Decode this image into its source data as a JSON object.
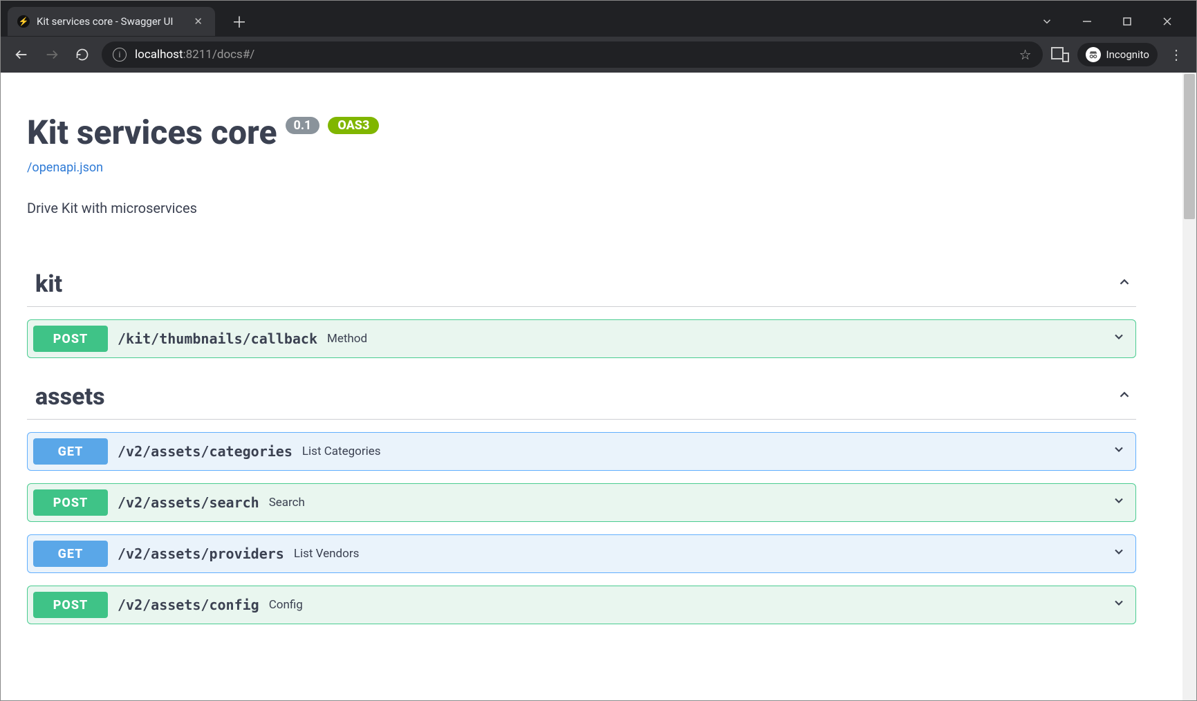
{
  "browser": {
    "tab_title": "Kit services core - Swagger UI",
    "incognito_label": "Incognito",
    "url_host": "localhost",
    "url_port": ":8211",
    "url_path": "/docs#/"
  },
  "api": {
    "title": "Kit services core",
    "version_badge": "0.1",
    "oas_badge": "OAS3",
    "spec_link": "/openapi.json",
    "description": "Drive Kit with microservices"
  },
  "tags": {
    "kit": {
      "name": "kit",
      "ops": [
        {
          "method": "POST",
          "path": "/kit/thumbnails/callback",
          "summary": "Method"
        }
      ]
    },
    "assets": {
      "name": "assets",
      "ops": [
        {
          "method": "GET",
          "path": "/v2/assets/categories",
          "summary": "List Categories"
        },
        {
          "method": "POST",
          "path": "/v2/assets/search",
          "summary": "Search"
        },
        {
          "method": "GET",
          "path": "/v2/assets/providers",
          "summary": "List Vendors"
        },
        {
          "method": "POST",
          "path": "/v2/assets/config",
          "summary": "Config"
        }
      ]
    }
  }
}
